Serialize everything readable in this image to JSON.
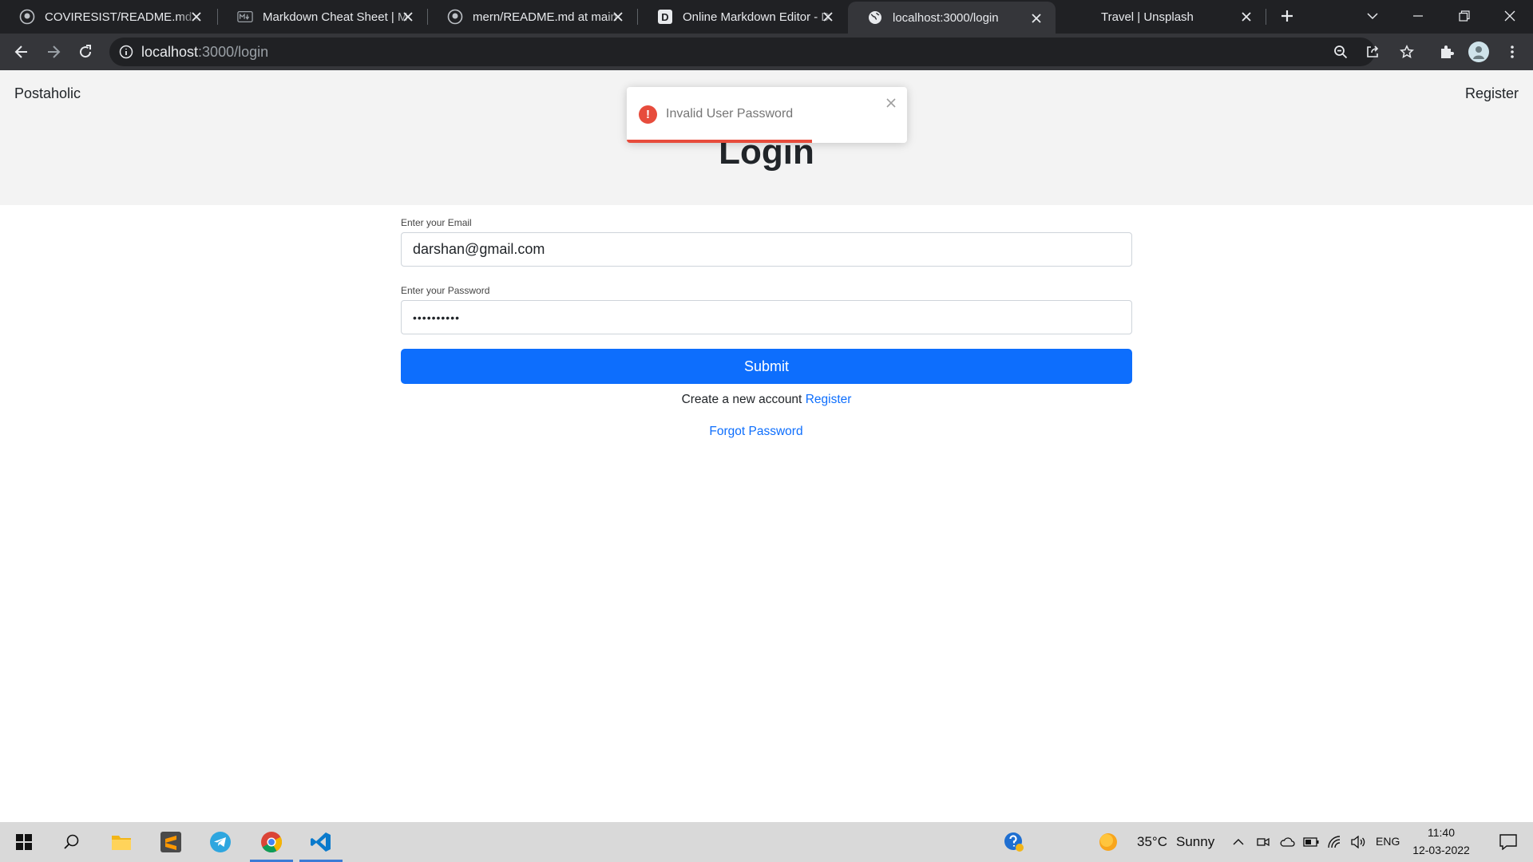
{
  "browser": {
    "tabs": [
      {
        "title": "COVIRESIST/README.md at",
        "favicon": "github-icon"
      },
      {
        "title": "Markdown Cheat Sheet | M",
        "favicon": "markdown-icon"
      },
      {
        "title": "mern/README.md at main",
        "favicon": "github-icon"
      },
      {
        "title": "Online Markdown Editor - D",
        "favicon": "dillinger-icon",
        "favicon_letter": "D"
      },
      {
        "title": "localhost:3000/login",
        "favicon": "globe-icon",
        "active": true
      },
      {
        "title": "Travel | Unsplash",
        "favicon": "unsplash-icon"
      }
    ],
    "url": {
      "host": "localhost",
      "path": ":3000/login"
    }
  },
  "app": {
    "brand": "Postaholic",
    "nav_register": "Register",
    "heading": "Login"
  },
  "toast": {
    "type": "error",
    "icon": "!",
    "message": "Invalid User Password",
    "progress": 0.66,
    "color": "#e74c3c"
  },
  "form": {
    "email_label": "Enter your Email",
    "email_value": "darshan@gmail.com",
    "password_label": "Enter your Password",
    "password_value": "••••••••••",
    "submit_label": "Submit",
    "create_text": "Create a new account",
    "register_link": "Register",
    "forgot_link": "Forgot Password",
    "accent": "#0d6efd"
  },
  "taskbar": {
    "weather_temp": "35°C",
    "weather_text": "Sunny",
    "language": "ENG",
    "time": "11:40",
    "date": "12-03-2022"
  }
}
